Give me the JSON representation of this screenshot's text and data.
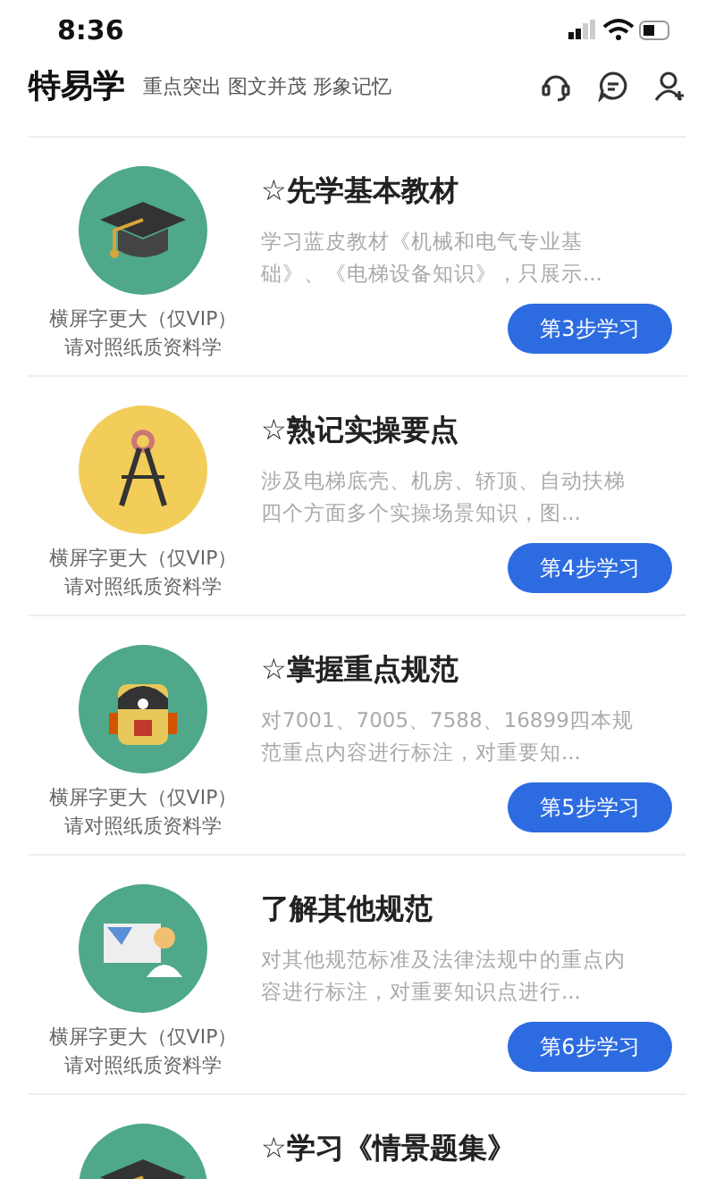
{
  "status_bar": {
    "time": "8:36"
  },
  "header": {
    "title": "特易学",
    "tagline": "重点突出 图文并茂 形象记忆"
  },
  "courses": [
    {
      "kind": "cap",
      "caption": [
        "横屏字更大（仅VIP）",
        "请对照纸质资料学"
      ],
      "title": "☆先学基本教材",
      "description": "学习蓝皮教材《机械和电气专业基础》、《电梯设备知识》，只展示...",
      "button": "第3步学习"
    },
    {
      "kind": "compass",
      "caption": [
        "横屏字更大（仅VIP）",
        "请对照纸质资料学"
      ],
      "title": "☆熟记实操要点",
      "description": "涉及电梯底壳、机房、轿顶、自动扶梯四个方面多个实操场景知识，图...",
      "button": "第4步学习"
    },
    {
      "kind": "backpack",
      "caption": [
        "横屏字更大（仅VIP）",
        "请对照纸质资料学"
      ],
      "title": "☆掌握重点规范",
      "description": "对7001、7005、7588、16899四本规范重点内容进行标注，对重要知...",
      "button": "第5步学习"
    },
    {
      "kind": "teacher",
      "caption": [
        "横屏字更大（仅VIP）",
        "请对照纸质资料学"
      ],
      "title": "了解其他规范",
      "description": "对其他规范标准及法律法规中的重点内容进行标注，对重要知识点进行...",
      "button": "第6步学习"
    },
    {
      "kind": "cap",
      "title": "☆学习《情景题集》"
    }
  ]
}
